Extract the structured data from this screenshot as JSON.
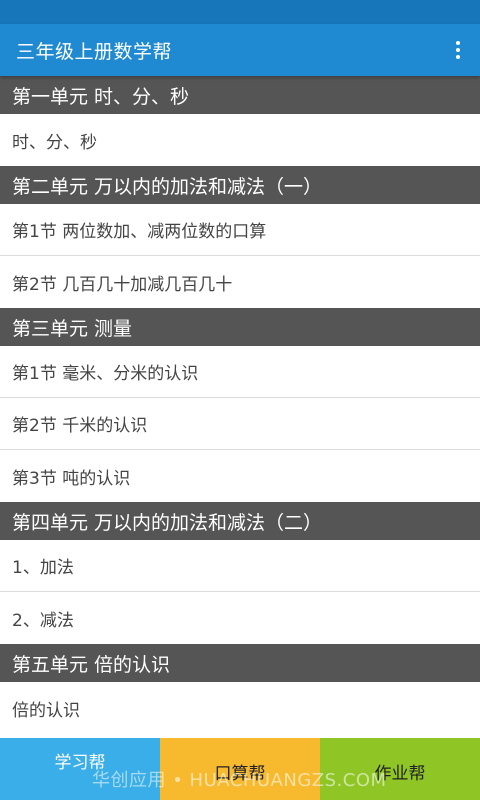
{
  "app_bar": {
    "title": "三年级上册数学帮",
    "menu_icon": "overflow-menu-icon"
  },
  "units": [
    {
      "title": "第一单元 时、分、秒",
      "items": [
        "时、分、秒"
      ]
    },
    {
      "title": "第二单元 万以内的加法和减法（一）",
      "items": [
        "第1节 两位数加、减两位数的口算",
        "第2节 几百几十加减几百几十"
      ]
    },
    {
      "title": "第三单元 测量",
      "items": [
        "第1节 毫米、分米的认识",
        "第2节 千米的认识",
        "第3节 吨的认识"
      ]
    },
    {
      "title": "第四单元 万以内的加法和减法（二）",
      "items": [
        "1、加法",
        "2、减法"
      ]
    },
    {
      "title": "第五单元 倍的认识",
      "items": [
        "倍的认识"
      ]
    }
  ],
  "tabs": [
    "学习帮",
    "口算帮",
    "作业帮"
  ],
  "watermark": "华创应用 • HUACHUANGZS.COM",
  "colors": {
    "status_bar": "#1775b9",
    "app_bar": "#1f8ad2",
    "section_header": "#555555",
    "tab_study": "#3aaee8",
    "tab_mental_math": "#f7ba2f",
    "tab_homework": "#8fc626"
  }
}
